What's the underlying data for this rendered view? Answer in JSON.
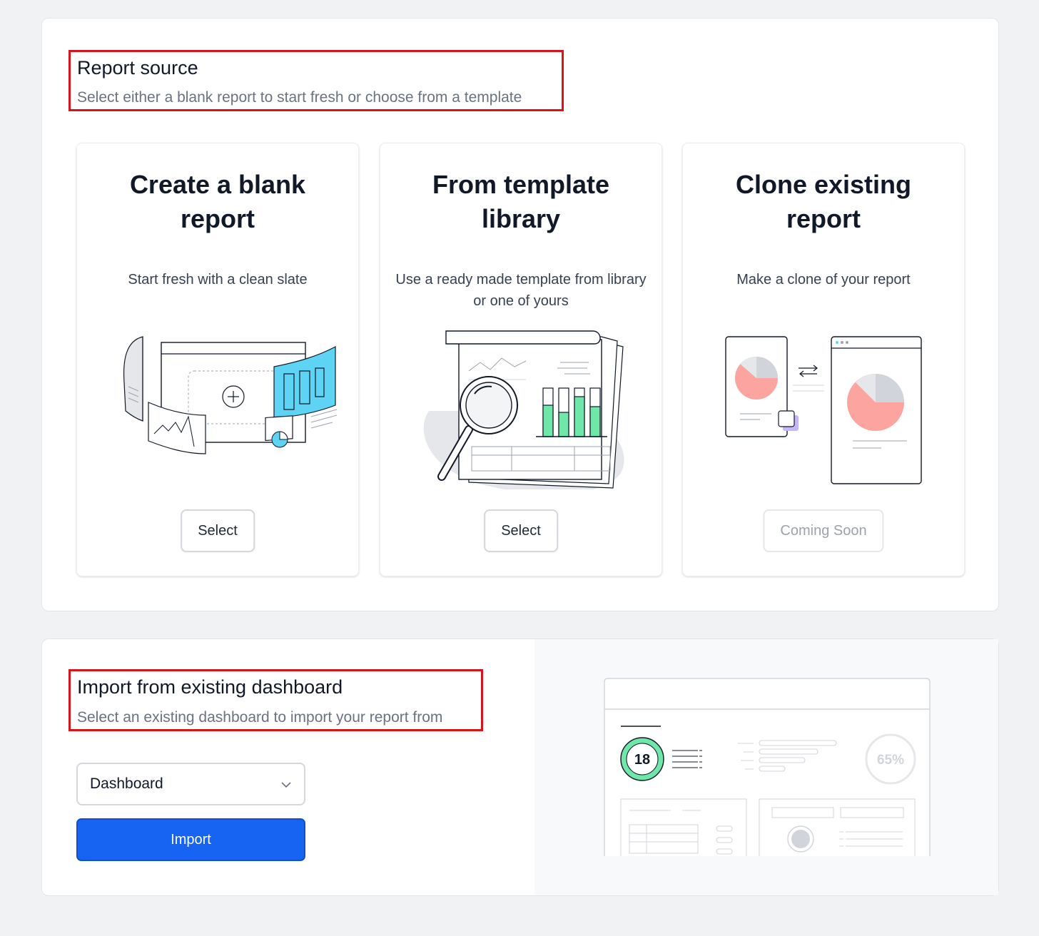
{
  "report_source": {
    "title": "Report source",
    "subtitle": "Select either a blank report to start fresh or choose from a template",
    "cards": [
      {
        "title": "Create a blank report",
        "description": "Start fresh with a clean slate",
        "button": "Select",
        "button_state": "enabled",
        "illustration": "blank-report-illustration"
      },
      {
        "title": "From template library",
        "description": "Use a ready made template from library or one of yours",
        "button": "Select",
        "button_state": "enabled",
        "illustration": "template-library-illustration"
      },
      {
        "title": "Clone existing report",
        "description": "Make a clone of your report",
        "button": "Coming Soon",
        "button_state": "disabled",
        "illustration": "clone-report-illustration"
      }
    ]
  },
  "import_section": {
    "title": "Import from existing dashboard",
    "subtitle": "Select an existing dashboard to import your report from",
    "dropdown_value": "Dashboard",
    "import_button": "Import",
    "preview": {
      "badge_value": "18",
      "percent_value": "65%"
    }
  },
  "colors": {
    "highlight": "#d7141a",
    "primary": "#1763f2",
    "accent_cyan": "#5fd3f3",
    "accent_green": "#6ee7a8",
    "accent_salmon": "#fca5a0",
    "accent_purple": "#c4b5fd"
  }
}
